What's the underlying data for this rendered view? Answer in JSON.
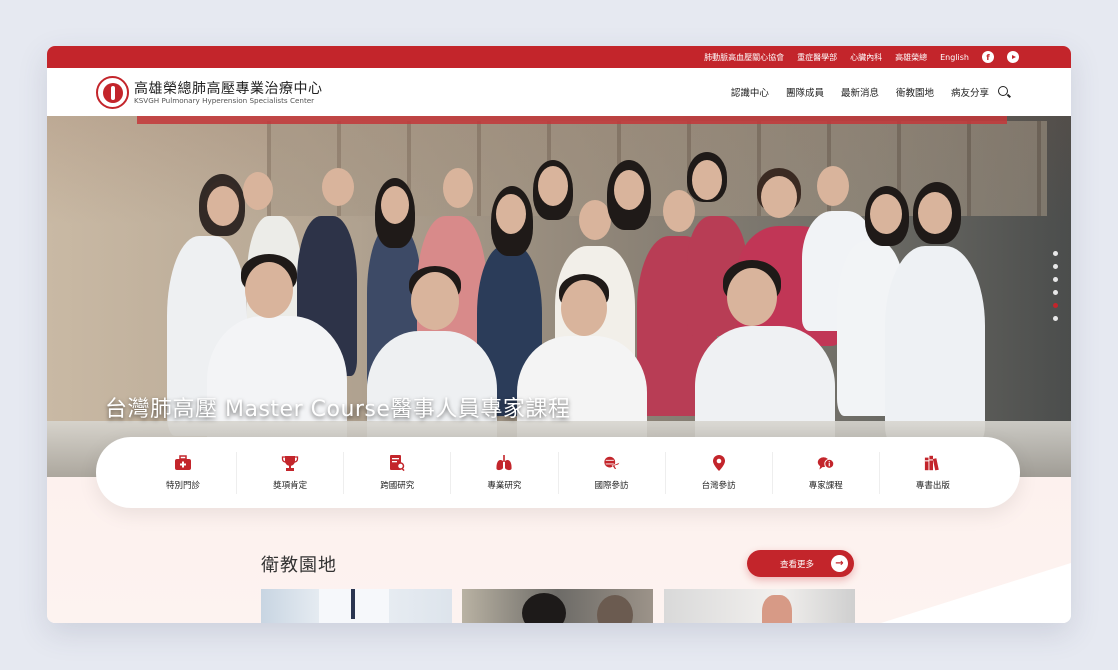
{
  "topbar": {
    "links": [
      "肺動脈高血壓關心協會",
      "重症醫學部",
      "心臟內科",
      "高雄榮總",
      "English"
    ],
    "facebook_icon": "facebook-icon",
    "youtube_icon": "youtube-icon"
  },
  "header": {
    "title": "高雄榮總肺高壓專業治療中心",
    "subtitle": "KSVGH Pulmonary Hyperension Specialists Center",
    "nav": [
      "認識中心",
      "團隊成員",
      "最新消息",
      "衛教園地",
      "病友分享"
    ]
  },
  "hero": {
    "caption": "台灣肺高壓 Master Course醫事人員專家課程",
    "slides": 6,
    "active_slide": 5
  },
  "quick_links": [
    {
      "label": "特別門診",
      "icon": "medical-kit-icon"
    },
    {
      "label": "獎項肯定",
      "icon": "trophy-icon"
    },
    {
      "label": "跨國研究",
      "icon": "document-search-icon"
    },
    {
      "label": "專業研究",
      "icon": "lungs-icon"
    },
    {
      "label": "國際參訪",
      "icon": "airplane-globe-icon"
    },
    {
      "label": "台灣參訪",
      "icon": "map-pin-icon"
    },
    {
      "label": "專家課程",
      "icon": "chat-info-icon"
    },
    {
      "label": "專書出版",
      "icon": "books-icon"
    }
  ],
  "section": {
    "title": "衛教園地",
    "more_label": "查看更多"
  },
  "colors": {
    "brand": "#c3252b",
    "section_bg": "#fdf1ee"
  }
}
